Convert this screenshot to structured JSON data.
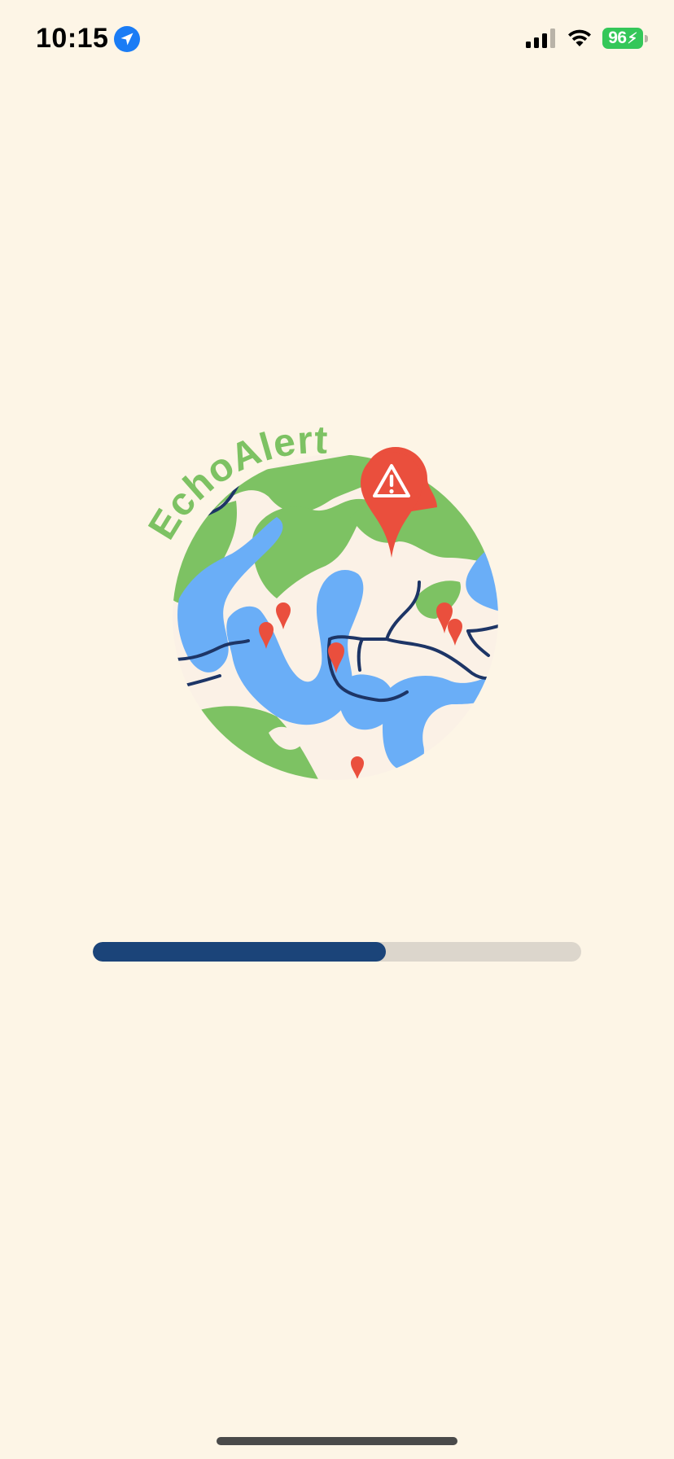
{
  "status_bar": {
    "time": "10:15",
    "battery_level": "96",
    "battery_charging": true,
    "icons": [
      "location-arrow-icon",
      "cellular-signal-icon",
      "wifi-icon",
      "battery-charging-icon"
    ]
  },
  "logo": {
    "text": "EchoAlert",
    "colors": {
      "land": "#7dc263",
      "water": "#6aaef7",
      "roads": "#1d3566",
      "pins": "#ea4f3d",
      "background": "#fbf1e6"
    },
    "icons": [
      "alert-map-pin-icon",
      "warning-triangle-icon",
      "map-pin-icon"
    ]
  },
  "loading": {
    "progress": 0.6
  },
  "theme": {
    "page_background": "#fdf5e6",
    "progress_fill": "#1b4479",
    "progress_track": "#dcd6cc",
    "battery_color": "#34c759"
  }
}
